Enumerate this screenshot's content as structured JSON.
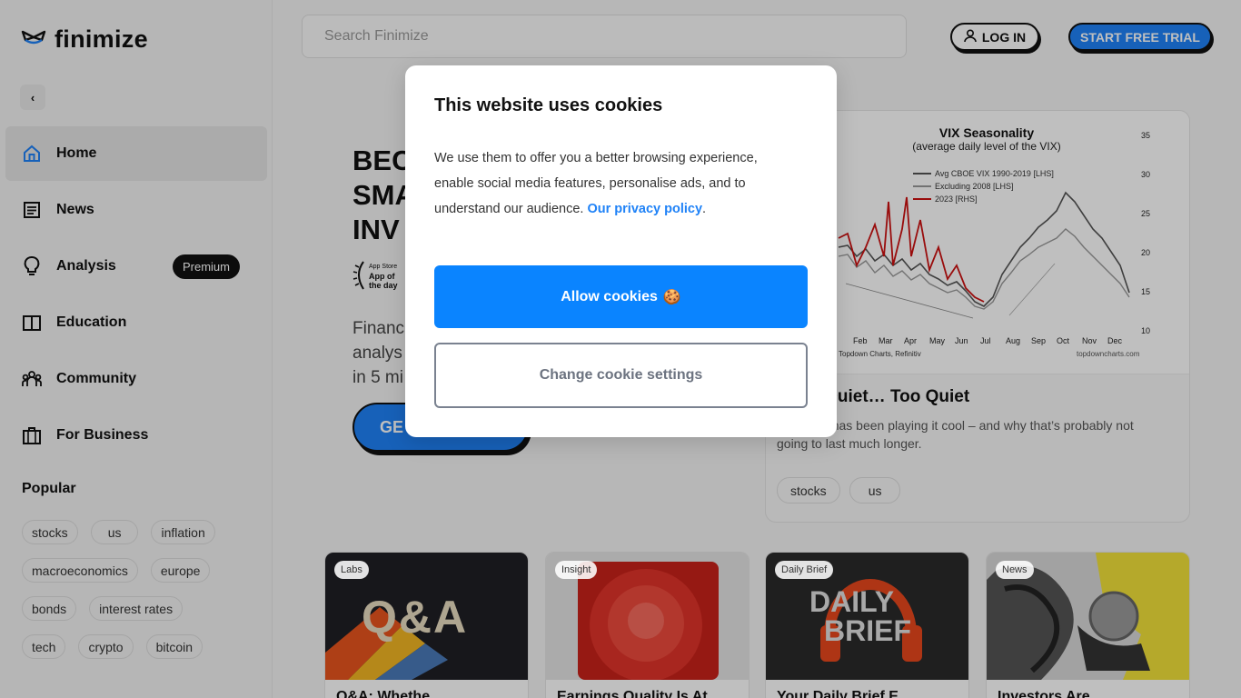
{
  "brand": {
    "name": "finimize",
    "logo_icon": "finimize-logo-icon"
  },
  "header": {
    "search_placeholder": "Search Finimize",
    "login_label": "LOG IN",
    "trial_label": "START FREE TRIAL"
  },
  "sidebar": {
    "collapse_icon": "chevron-left-icon",
    "items": [
      {
        "label": "Home",
        "icon": "home-icon",
        "active": true
      },
      {
        "label": "News",
        "icon": "newspaper-icon"
      },
      {
        "label": "Analysis",
        "icon": "lightbulb-icon",
        "badge": "Premium"
      },
      {
        "label": "Education",
        "icon": "book-icon"
      },
      {
        "label": "Community",
        "icon": "people-icon"
      },
      {
        "label": "For Business",
        "icon": "briefcase-icon"
      }
    ],
    "popular_title": "Popular",
    "popular_tags": [
      [
        "stocks",
        "us",
        "inflation"
      ],
      [
        "macroeconomics",
        "europe"
      ],
      [
        "bonds",
        "interest rates"
      ],
      [
        "tech",
        "crypto",
        "bitcoin"
      ]
    ]
  },
  "hero": {
    "title_lines": [
      "BEC",
      "SMA",
      "INV"
    ],
    "badge_lines": [
      "App Store",
      "App of",
      "the day"
    ],
    "subtitle_lines": [
      "Financ",
      "analys",
      "in 5 mi"
    ],
    "cta_label": "GE"
  },
  "feature": {
    "chart": {
      "title": "VIX Seasonality",
      "subtitle": "(average daily level of the VIX)",
      "legend": [
        "Avg CBOE VIX 1990-2019 [LHS]",
        "Excluding 2008 [LHS]",
        "2023 [RHS]"
      ],
      "legend_colors": [
        "#555555",
        "#999999",
        "#cc1111"
      ],
      "x_ticks": [
        "Feb",
        "Mar",
        "Apr",
        "May",
        "Jun",
        "Jul",
        "Aug",
        "Sep",
        "Oct",
        "Nov",
        "Dec"
      ],
      "y_ticks_right": [
        "35",
        "30",
        "25",
        "20",
        "15",
        "10"
      ],
      "source_left": "Topdown Charts, Refinitiv",
      "source_right": "topdowncharts.com"
    },
    "title": "s Are Quiet… Too Quiet",
    "description": "y the VIX has been playing it cool – and why that’s probably not going to last much longer.",
    "tags": [
      "stocks",
      "us"
    ]
  },
  "cards": [
    {
      "label": "Labs",
      "title": "Q&A: Whethe",
      "image_text": "Q&A"
    },
    {
      "label": "Insight",
      "title": "Earnings Quality Is At",
      "image_text": ""
    },
    {
      "label": "Daily Brief",
      "title": "Your Daily Brief E",
      "image_text_lines": [
        "DAILY",
        "BRIEF"
      ]
    },
    {
      "label": "News",
      "title": "Investors Are",
      "image_text": ""
    }
  ],
  "cookie_modal": {
    "title": "This website uses cookies",
    "text": "We use them to offer you a better browsing experience, enable social media features, personalise ads, and to understand our audience.",
    "policy_link": "Our privacy policy",
    "policy_suffix": ".",
    "allow_label": "Allow cookies",
    "allow_emoji": "🍪",
    "settings_label": "Change cookie settings"
  }
}
